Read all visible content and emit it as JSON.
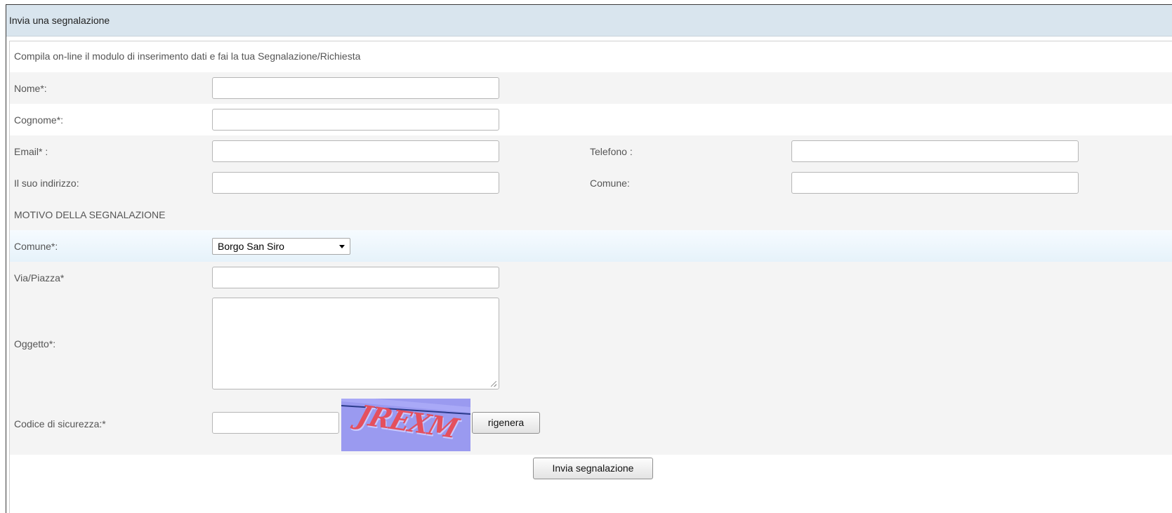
{
  "header": {
    "title": "Invia una segnalazione"
  },
  "form": {
    "intro": "Compila on-line il modulo di inserimento dati e fai la tua Segnalazione/Richiesta",
    "fields": {
      "nome": {
        "label": "Nome*:",
        "value": ""
      },
      "cognome": {
        "label": "Cognome*:",
        "value": ""
      },
      "email": {
        "label": "Email* :",
        "value": ""
      },
      "telefono": {
        "label": "Telefono :",
        "value": ""
      },
      "indirizzo": {
        "label": "Il suo indirizzo:",
        "value": ""
      },
      "comune_residenza": {
        "label": "Comune:",
        "value": ""
      }
    },
    "section_title": "MOTIVO DELLA SEGNALAZIONE",
    "comune_select": {
      "label": "Comune*:",
      "selected": "Borgo San Siro"
    },
    "via": {
      "label": "Via/Piazza*",
      "value": ""
    },
    "oggetto": {
      "label": "Oggetto*:",
      "value": ""
    },
    "captcha": {
      "label": "Codice di sicurezza:*",
      "value": "",
      "image_text": "JREXM",
      "refresh_label": "rigenera"
    },
    "submit_label": "Invia segnalazione"
  },
  "colors": {
    "title_bar_bg": "#d9e5ee",
    "row_gray_bg": "#f4f4f4",
    "row_highlight_bg": "#e6f2fa",
    "captcha_bg": "#9a9af0",
    "captcha_text": "#e4505e"
  },
  "icons": {
    "select_arrow": "chevron-down-icon",
    "textarea_grip": "resize-grip-icon"
  }
}
